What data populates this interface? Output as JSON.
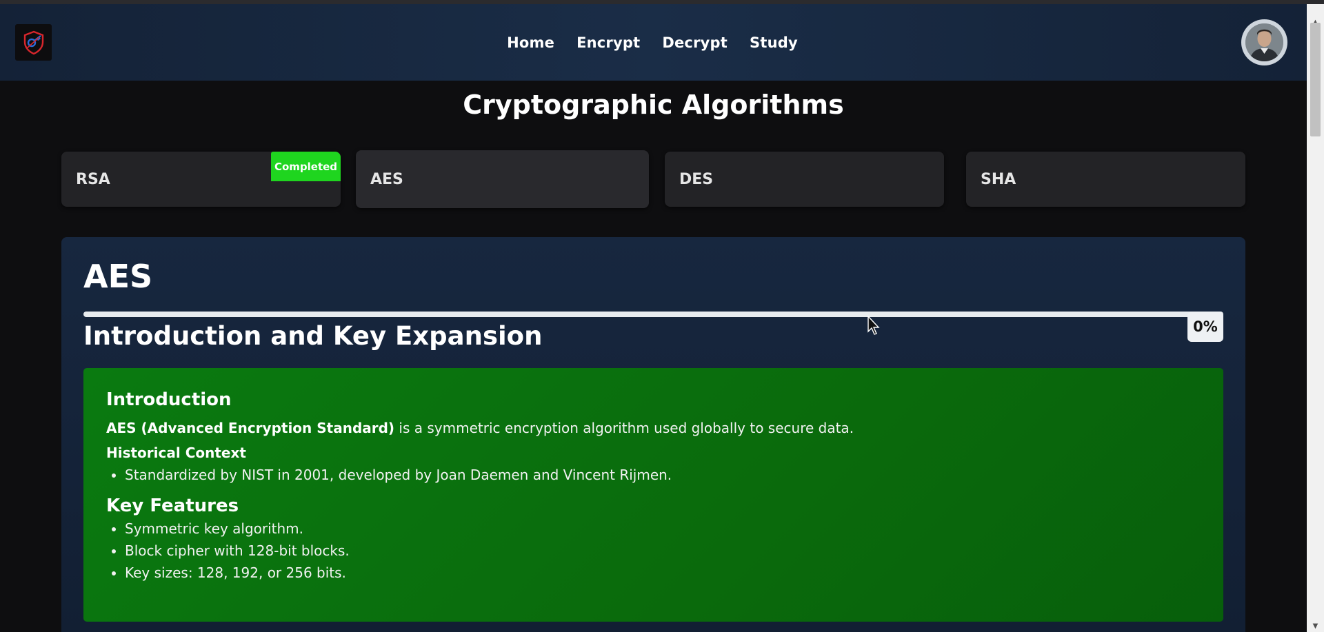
{
  "nav": {
    "links": [
      "Home",
      "Encrypt",
      "Decrypt",
      "Study"
    ],
    "logo_icon": "shield-key-icon",
    "avatar_icon": "user-avatar"
  },
  "page": {
    "title": "Cryptographic Algorithms"
  },
  "algorithms": [
    {
      "label": "RSA",
      "badge": "Completed"
    },
    {
      "label": "AES",
      "badge": ""
    },
    {
      "label": "DES",
      "badge": ""
    },
    {
      "label": "SHA",
      "badge": ""
    }
  ],
  "panel": {
    "title": "AES",
    "progress_percent": 0,
    "progress_label": "0%",
    "section_title": "Introduction and Key Expansion",
    "content": {
      "intro_heading": "Introduction",
      "intro_bold": "AES (Advanced Encryption Standard)",
      "intro_text": " is a symmetric encryption algorithm used globally to secure data.",
      "history_heading": "Historical Context",
      "history_items": [
        "Standardized by NIST in 2001, developed by Joan Daemen and Vincent Rijmen."
      ],
      "features_heading": "Key Features",
      "features_items": [
        "Symmetric key algorithm.",
        "Block cipher with 128-bit blocks.",
        "Key sizes: 128, 192, or 256 bits."
      ]
    }
  },
  "colors": {
    "navbar": "#1a2d47",
    "badge": "#1fd51f",
    "content_green": "#0a6a0c",
    "panel": "#17273f"
  }
}
